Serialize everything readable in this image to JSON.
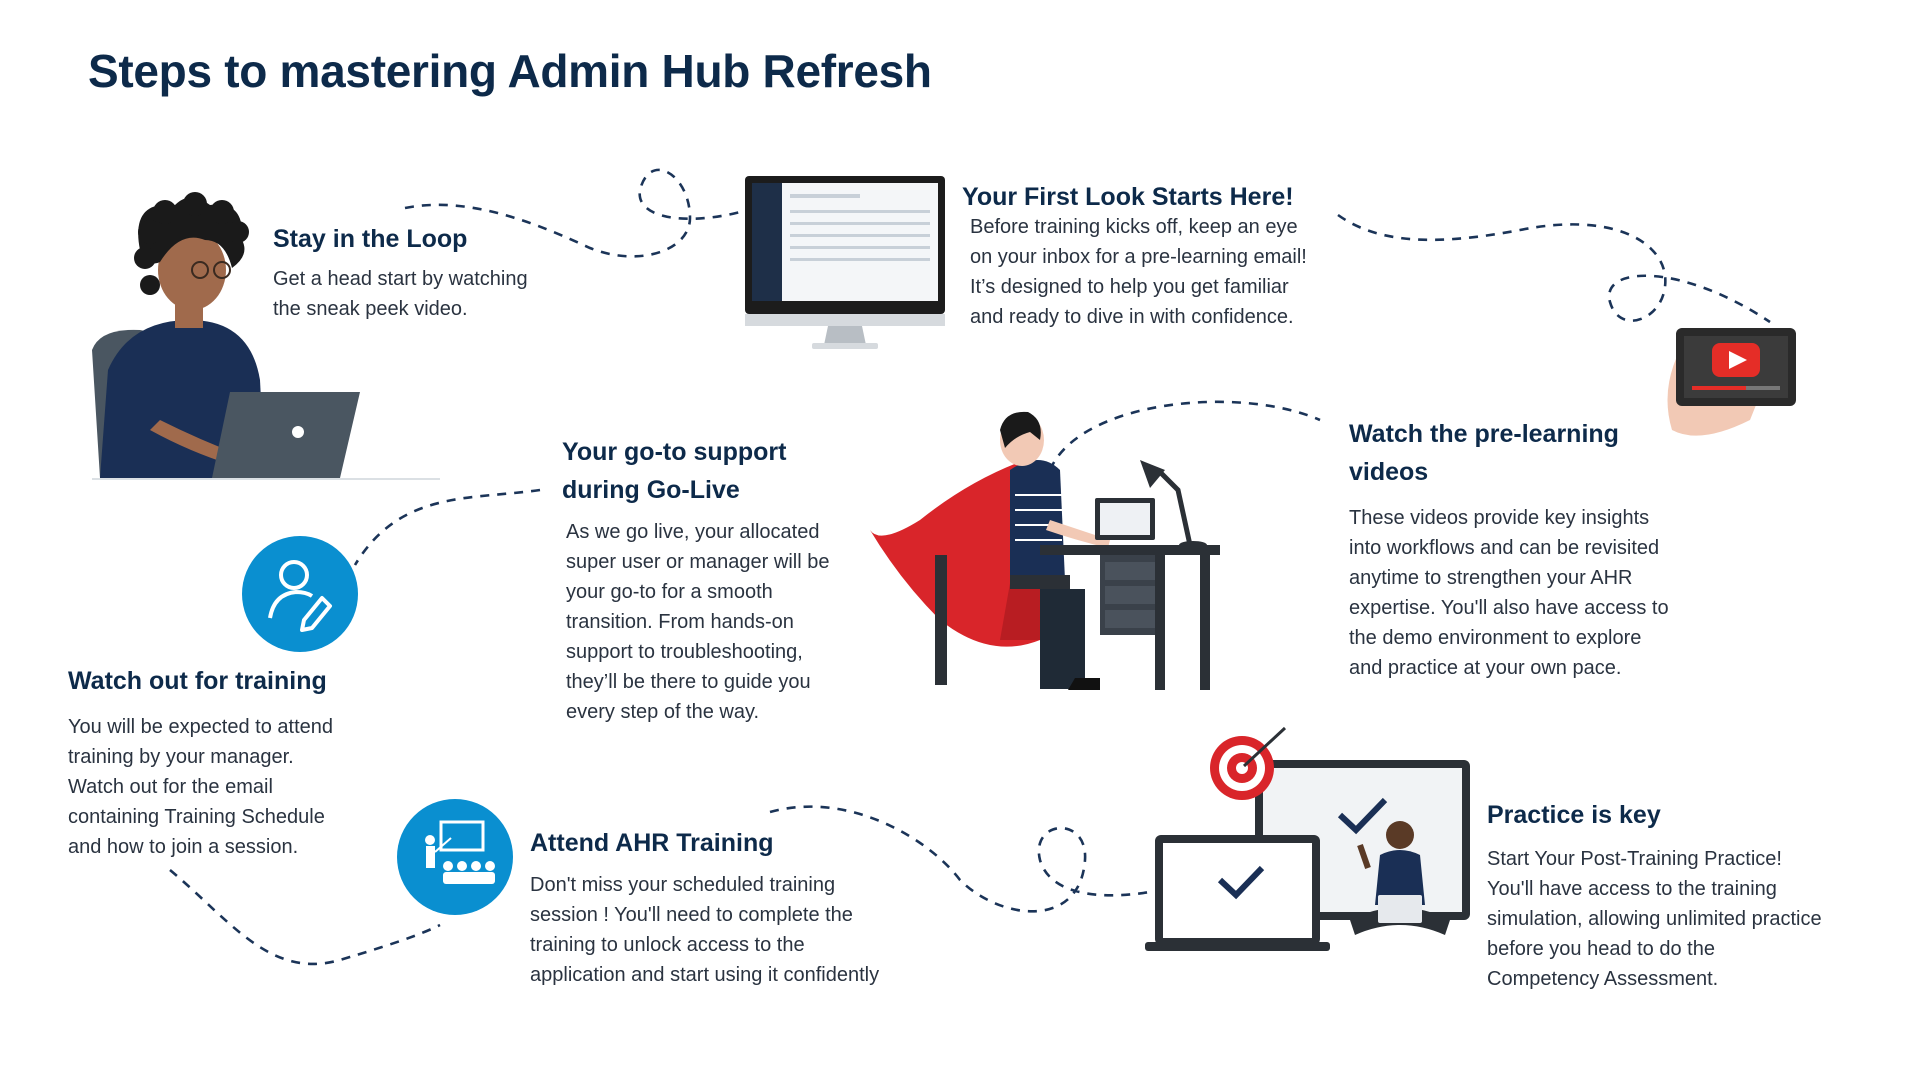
{
  "page": {
    "title": "Steps to mastering Admin Hub Refresh"
  },
  "steps": [
    {
      "title": "Stay in the Loop",
      "body": [
        "Get a head start by watching",
        "the sneak peek video."
      ]
    },
    {
      "title": "Your First Look Starts Here!",
      "body": [
        "Before training kicks off, keep an eye",
        "on your inbox for a pre-learning email!",
        "It’s designed to help you get familiar",
        "and ready to dive in with confidence."
      ]
    },
    {
      "title_lines": [
        "Watch the pre-learning",
        "videos"
      ],
      "body": [
        "These videos provide key insights",
        "into workflows and can be revisited",
        "anytime to strengthen your AHR",
        "expertise. You'll also have access to",
        "the demo environment to explore",
        "and practice at your own pace."
      ]
    },
    {
      "title_lines": [
        "Your go-to support",
        "during Go-Live"
      ],
      "body": [
        "As we go live, your allocated",
        "super user or manager will be",
        "your go-to for a smooth",
        "transition. From hands-on",
        "support to troubleshooting,",
        "they’ll be there to guide you",
        "every step of the way."
      ]
    },
    {
      "title": "Watch out for training",
      "body": [
        "You will be expected to attend",
        "training by your manager.",
        "Watch out for the email",
        "containing Training Schedule",
        "and how to join a session."
      ]
    },
    {
      "title": "Attend AHR Training",
      "body": [
        "Don't miss your scheduled  training",
        "session ! You'll need to complete the",
        "training to unlock access to the",
        "application and start using it confidently"
      ]
    },
    {
      "title": "Practice is key",
      "body": [
        "Start Your Post-Training Practice!",
        "You'll have access to the training",
        "simulation, allowing unlimited practice",
        "before you head to do the",
        "Competency Assessment."
      ]
    }
  ],
  "colors": {
    "title": "#0d2a4a",
    "accent_blue": "#0a8fd0",
    "navy": "#1a2f55",
    "cape_red": "#d9252a",
    "youtube_red": "#e52d27",
    "path": "#1b3458"
  },
  "icons": {
    "training_icon": "user-edit-icon",
    "attend_icon": "presentation-icon",
    "video_icon": "play-icon"
  }
}
